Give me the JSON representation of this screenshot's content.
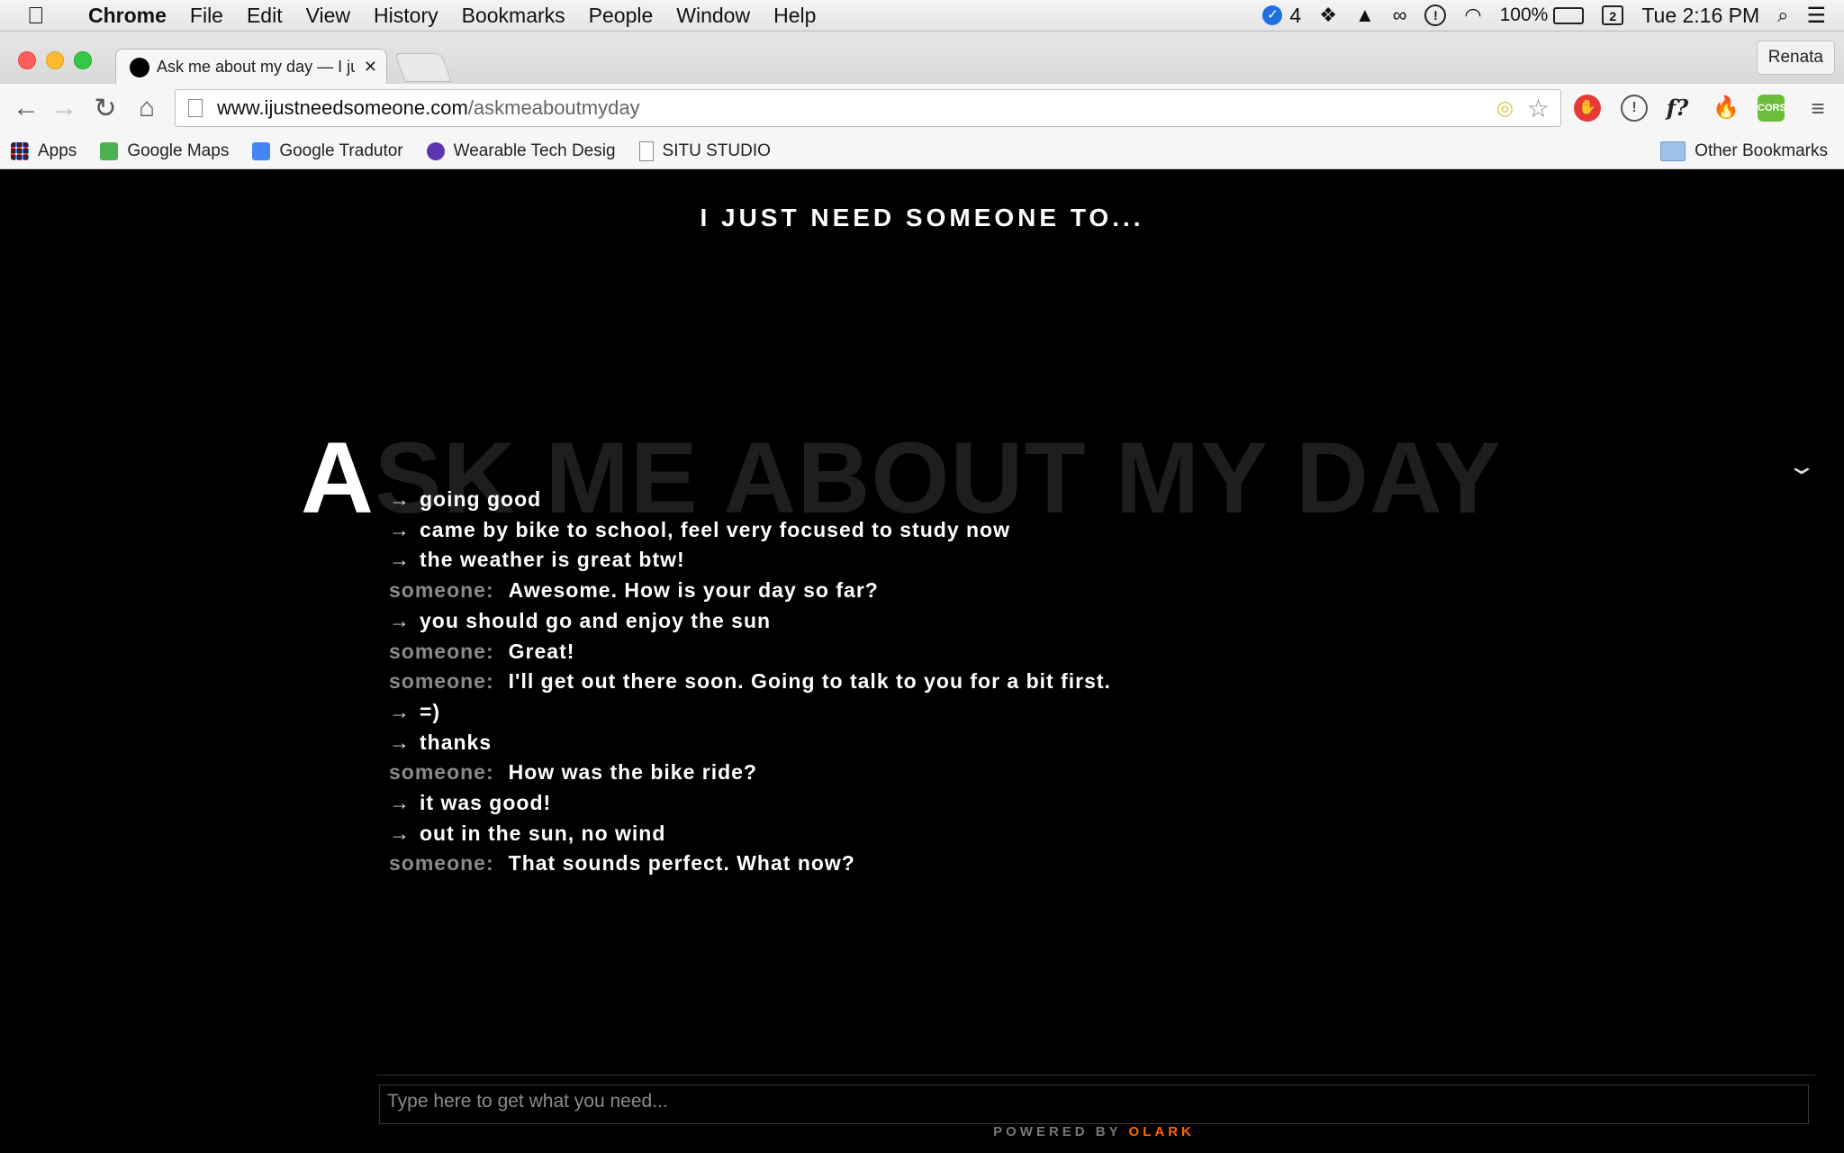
{
  "menubar": {
    "app": "Chrome",
    "items": [
      "File",
      "Edit",
      "View",
      "History",
      "Bookmarks",
      "People",
      "Window",
      "Help"
    ],
    "mail_count": "4",
    "battery": "100%",
    "calendar_day": "2",
    "clock": "Tue 2:16 PM"
  },
  "browser": {
    "tab_title": "Ask me about my day — I ju",
    "profile": "Renata",
    "url_host": "www.ijustneedsomeone.com",
    "url_path": "/askmeaboutmyday",
    "ext_f": "f?",
    "ext_cors": "CORS",
    "bookmarks": [
      {
        "label": "Apps",
        "icon": "apps-grid-icon",
        "color": "#e53935"
      },
      {
        "label": "Google Maps",
        "icon": "maps-icon",
        "color": "#4caf50"
      },
      {
        "label": "Google Tradutor",
        "icon": "translate-icon",
        "color": "#4285f4"
      },
      {
        "label": "Wearable Tech Desig",
        "icon": "itp-icon",
        "color": "#5e35b1"
      },
      {
        "label": "SITU STUDIO",
        "icon": "page-icon",
        "color": "#ffffff"
      }
    ],
    "other_bookmarks": "Other Bookmarks"
  },
  "page": {
    "site_title": "I JUST NEED SOMEONE TO...",
    "heading_first": "A",
    "heading_rest": "SK ME ABOUT MY DAY",
    "chat": [
      {
        "from": "me",
        "arrow": "→",
        "text": "going good"
      },
      {
        "from": "me",
        "arrow": "→",
        "text": "came by bike to school, feel very focused to study now"
      },
      {
        "from": "me",
        "arrow": "→",
        "text": "the weather is great btw!"
      },
      {
        "from": "someone",
        "who": "someone:",
        "text": "Awesome. How is your day so far?"
      },
      {
        "from": "me",
        "arrow": "→",
        "text": "you should go and enjoy the sun"
      },
      {
        "from": "someone",
        "who": "someone:",
        "text": "Great!"
      },
      {
        "from": "someone",
        "who": "someone:",
        "text": "I'll get out there soon. Going to talk to you for a bit first."
      },
      {
        "from": "me",
        "arrow": "→",
        "text": "=)"
      },
      {
        "from": "me",
        "arrow": "→",
        "text": "thanks"
      },
      {
        "from": "someone",
        "who": "someone:",
        "text": "How was the bike ride?"
      },
      {
        "from": "me",
        "arrow": "→",
        "text": "it was good!"
      },
      {
        "from": "me",
        "arrow": "→",
        "text": "out in the sun, no wind"
      },
      {
        "from": "someone",
        "who": "someone:",
        "text": "That sounds perfect. What now?"
      }
    ],
    "input_placeholder": "Type here to get what you need...",
    "powered_by": "POWERED BY",
    "powered_brand": "OLARK"
  }
}
